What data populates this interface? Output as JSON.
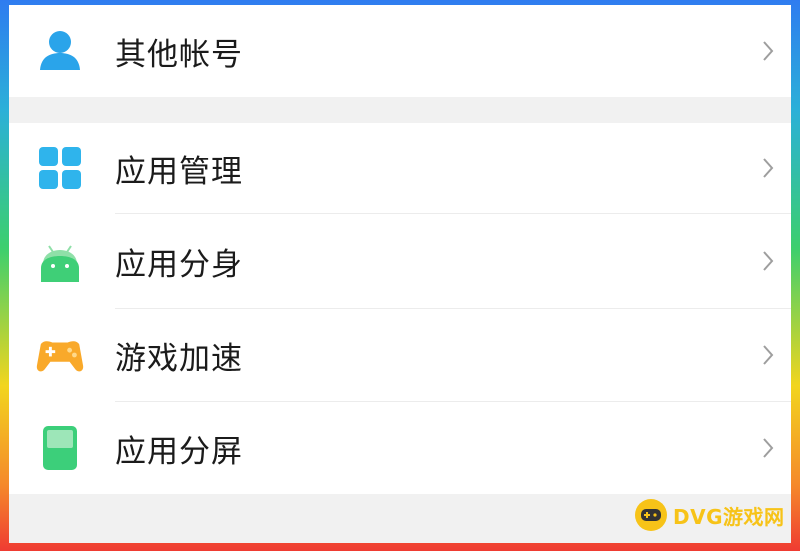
{
  "settings": {
    "items": [
      {
        "label": "其他帐号",
        "icon": "person-icon"
      },
      {
        "label": "应用管理",
        "icon": "apps-grid-icon"
      },
      {
        "label": "应用分身",
        "icon": "android-clone-icon"
      },
      {
        "label": "游戏加速",
        "icon": "gamepad-icon"
      },
      {
        "label": "应用分屏",
        "icon": "split-screen-icon"
      }
    ]
  },
  "watermark": {
    "text": "DVG游戏网"
  },
  "colors": {
    "person": "#2aa4ea",
    "apps": "#2fb4ec",
    "clone": "#3fcf77",
    "game": "#f9a92a",
    "split": "#3ccf7a",
    "chevron": "#9e9e9e",
    "watermark": "#f7c318"
  }
}
